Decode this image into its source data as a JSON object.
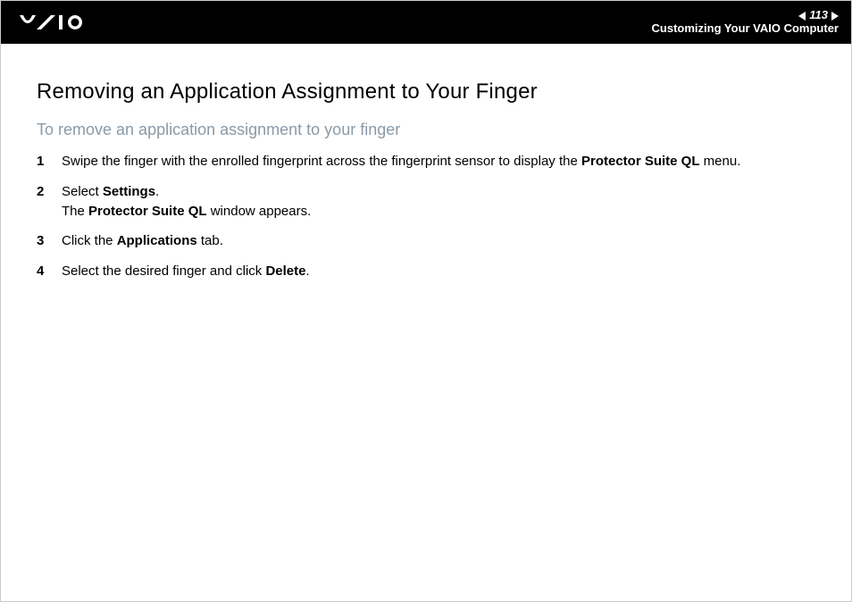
{
  "header": {
    "page_number": "113",
    "section_title": "Customizing Your VAIO Computer"
  },
  "content": {
    "title": "Removing an Application Assignment to Your Finger",
    "subtitle": "To remove an application assignment to your finger",
    "steps": [
      {
        "pre1": "Swipe the finger with the enrolled fingerprint across the fingerprint sensor to display the ",
        "bold1": "Protector Suite QL",
        "post1": " menu."
      },
      {
        "pre1": "Select ",
        "bold1": "Settings",
        "post1": ".",
        "line2_pre": "The ",
        "line2_bold": "Protector Suite QL",
        "line2_post": " window appears."
      },
      {
        "pre1": "Click the ",
        "bold1": "Applications",
        "post1": " tab."
      },
      {
        "pre1": "Select the desired finger and click ",
        "bold1": "Delete",
        "post1": "."
      }
    ]
  }
}
